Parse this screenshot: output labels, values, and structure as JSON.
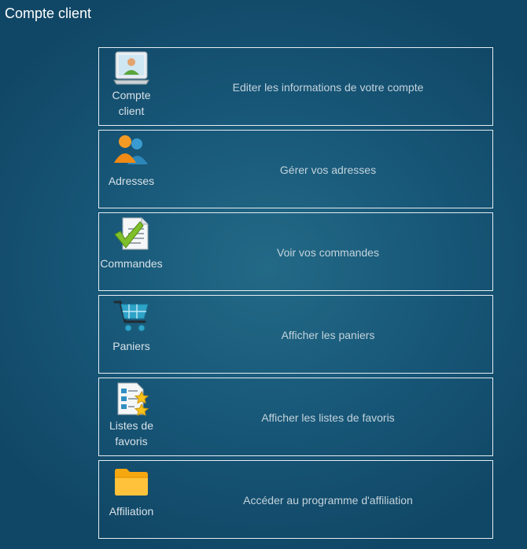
{
  "page": {
    "title": "Compte client"
  },
  "tiles": [
    {
      "label": "Compte client",
      "description": "Editer les informations de votre compte",
      "icon": "user-account-icon"
    },
    {
      "label": "Adresses",
      "description": "Gérer vos adresses",
      "icon": "users-icon"
    },
    {
      "label": "Commandes",
      "description": "Voir vos commandes",
      "icon": "order-checklist-icon"
    },
    {
      "label": "Paniers",
      "description": "Afficher les paniers",
      "icon": "shopping-cart-icon"
    },
    {
      "label": "Listes de favoris",
      "description": "Afficher les listes de favoris",
      "icon": "favorites-list-icon"
    },
    {
      "label": "Affiliation",
      "description": "Accéder au programme d'affiliation",
      "icon": "folder-icon"
    }
  ]
}
